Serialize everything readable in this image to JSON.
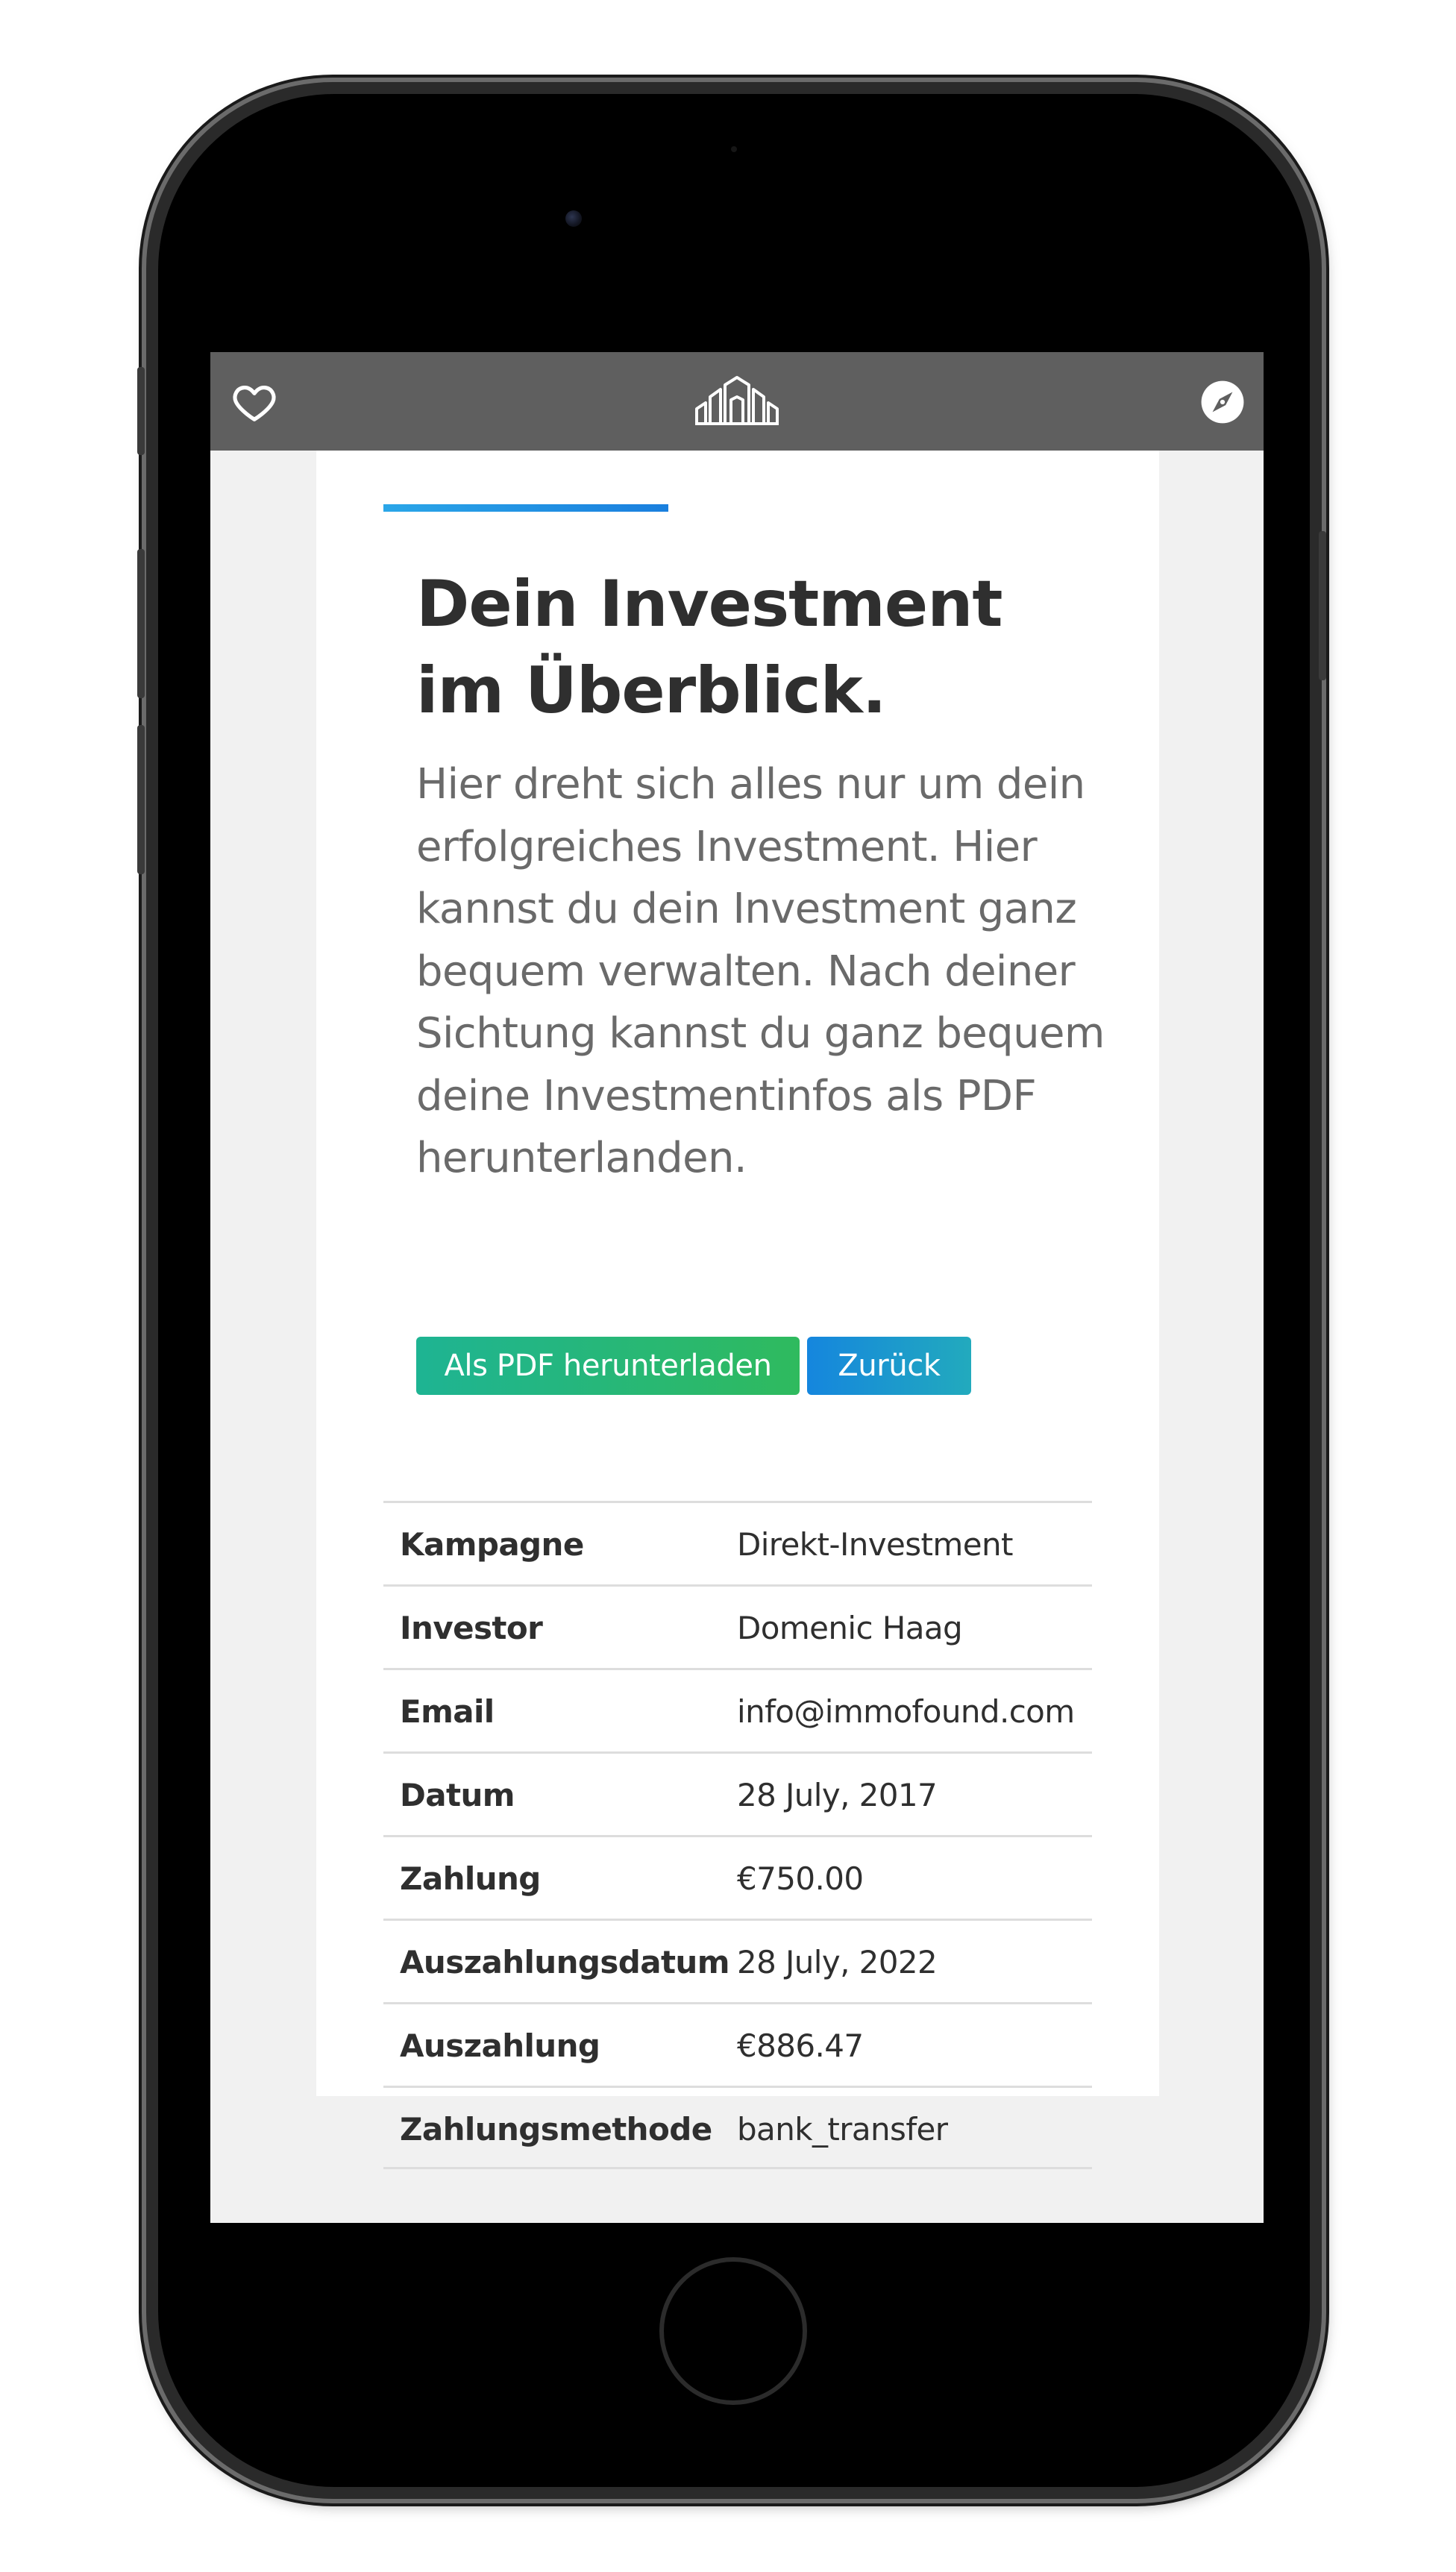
{
  "topbar": {
    "left_icon": "heart-icon",
    "logo_icon": "immofound-logo-icon",
    "right_icon": "compass-icon",
    "background_color": "#5f5f5f"
  },
  "main": {
    "title": "Dein Investment im Überblick.",
    "intro": "Hier dreht sich alles nur um dein erfolgreiches Investment. Hier kannst du dein Investment ganz bequem verwalten. Nach deiner Sichtung kannst du ganz bequem deine Investmentinfos als PDF herunterlanden.",
    "accent_color": "#1a8fe3"
  },
  "actions": {
    "pdf_label": "Als PDF herunterladen",
    "back_label": "Zurück",
    "pdf_color": "#27b77a",
    "back_color": "#1a98d0"
  },
  "details": {
    "rows": [
      {
        "label": "Kampagne",
        "value": "Direkt-Investment"
      },
      {
        "label": "Investor",
        "value": "Domenic Haag"
      },
      {
        "label": "Email",
        "value": "info@immofound.com"
      },
      {
        "label": "Datum",
        "value": "28 July, 2017"
      },
      {
        "label": "Zahlung",
        "value": "€750.00"
      },
      {
        "label": "Auszahlungsdatum",
        "value": "28 July, 2022"
      },
      {
        "label": "Auszahlung",
        "value": "€886.47"
      },
      {
        "label": "Zahlungsmethode",
        "value": "bank_transfer"
      }
    ]
  }
}
